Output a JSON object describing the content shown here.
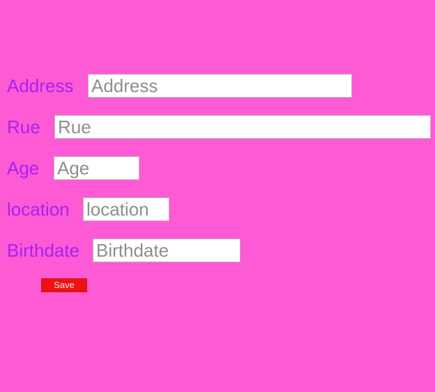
{
  "form": {
    "fields": [
      {
        "label": "Address",
        "placeholder": "Address",
        "value": ""
      },
      {
        "label": "Rue",
        "placeholder": "Rue",
        "value": ""
      },
      {
        "label": "Age",
        "placeholder": "Age",
        "value": ""
      },
      {
        "label": "location",
        "placeholder": "location",
        "value": ""
      },
      {
        "label": "Birthdate",
        "placeholder": "Birthdate",
        "value": ""
      }
    ],
    "save_label": "Save"
  },
  "colors": {
    "background": "#ff5ad6",
    "label": "#a524ee",
    "save_button": "#ee1111",
    "save_text": "#ececec"
  }
}
